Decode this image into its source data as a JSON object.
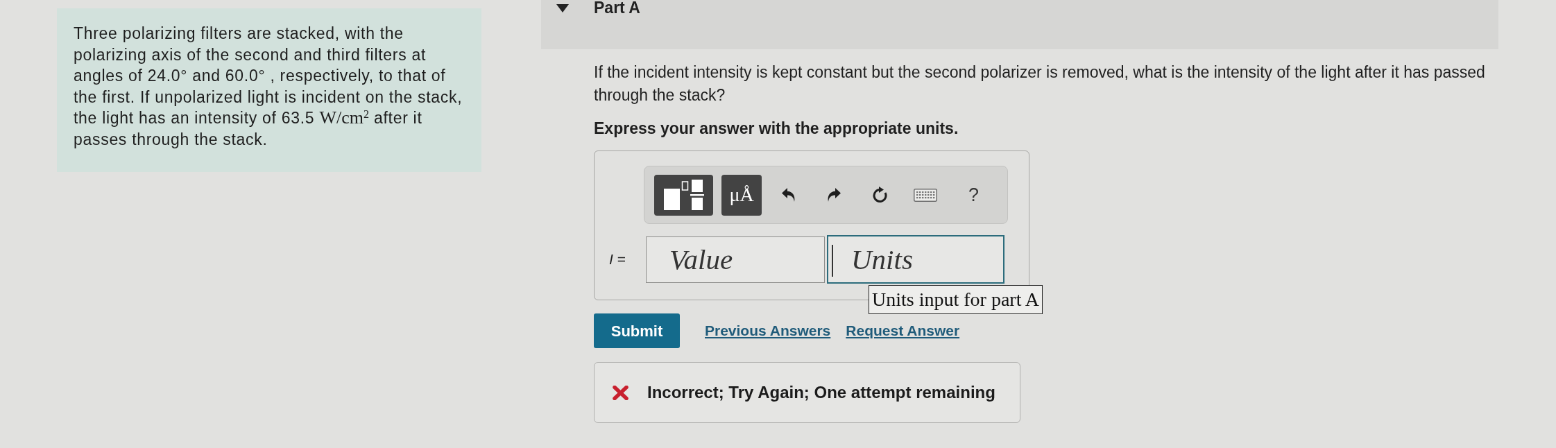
{
  "problem": {
    "segments": [
      {
        "kind": "text",
        "text": "Three polarizing filters are stacked, with the polarizing axis of the second and third filters at angles of 24.0° and 60.0° , respectively, to that of the first. If unpolarized light is incident on the stack, the light has an intensity of 63.5 "
      },
      {
        "kind": "math",
        "text": "W/cm$^{2}$"
      },
      {
        "kind": "text",
        "text": " after it passes through the stack."
      }
    ]
  },
  "part": {
    "title": "Part A",
    "expanded": true
  },
  "question": "If the incident intensity is kept constant but the second polarizer is removed, what is the intensity of the light after it has passed through the stack?",
  "instruction": "Express your answer with the appropriate units.",
  "answer": {
    "toolbar": [
      {
        "kind": "templates"
      },
      {
        "kind": "symbols",
        "label": "μÅ"
      },
      {
        "kind": "undo"
      },
      {
        "kind": "redo"
      },
      {
        "kind": "reset"
      },
      {
        "kind": "keyboard"
      },
      {
        "kind": "help",
        "label": "?"
      }
    ],
    "label": "*I* =",
    "fields": [
      {
        "placeholder": "Value",
        "focused": false
      },
      {
        "placeholder": "Units",
        "focused": true,
        "tooltip": "Units input for part A"
      }
    ]
  },
  "actions": {
    "submit": "Submit",
    "links": [
      "Previous Answers",
      "Request Answer"
    ]
  },
  "feedback": {
    "kind": "incorrect",
    "text": "Incorrect; Try Again; One attempt remaining"
  }
}
